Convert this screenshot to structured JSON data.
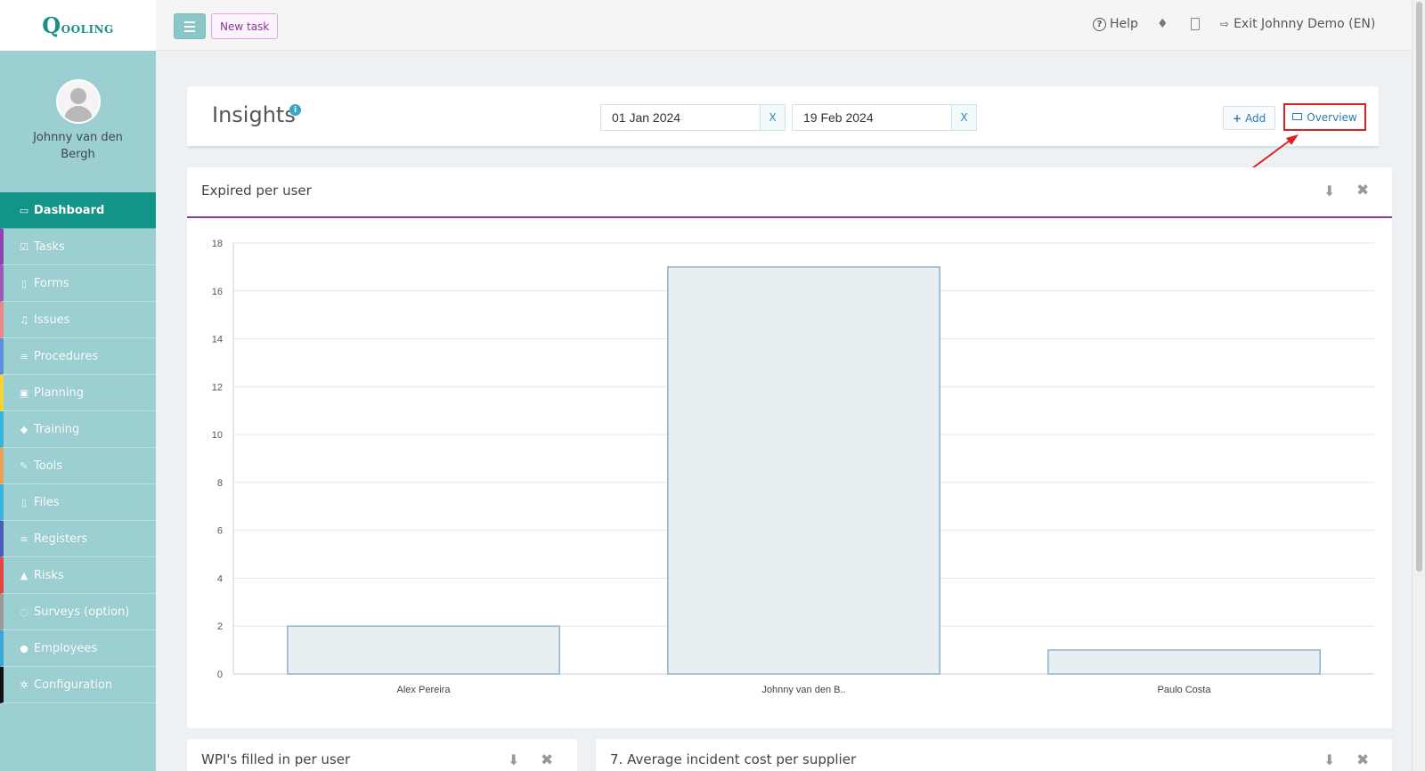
{
  "app": {
    "logo_text": "Qooling"
  },
  "topbar": {
    "new_task": "New task",
    "help": "Help",
    "exit": "Exit Johnny Demo (EN)"
  },
  "profile": {
    "name": "Johnny van den Bergh"
  },
  "nav": {
    "items": [
      {
        "label": "Dashboard",
        "icon": "monitor-icon",
        "glyph": "▭",
        "color": "#139488"
      },
      {
        "label": "Tasks",
        "icon": "checkbox-icon",
        "glyph": "☑",
        "color": "#8e44ad"
      },
      {
        "label": "Forms",
        "icon": "document-icon",
        "glyph": "▯",
        "color": "#9b59b6"
      },
      {
        "label": "Issues",
        "icon": "bell-icon",
        "glyph": "♫",
        "color": "#e78989"
      },
      {
        "label": "Procedures",
        "icon": "list-icon",
        "glyph": "≡",
        "color": "#5b8fd6"
      },
      {
        "label": "Planning",
        "icon": "calendar-icon",
        "glyph": "▣",
        "color": "#f0d43a"
      },
      {
        "label": "Training",
        "icon": "graduation-cap-icon",
        "glyph": "◆",
        "color": "#39b3d7"
      },
      {
        "label": "Tools",
        "icon": "wrench-icon",
        "glyph": "✎",
        "color": "#e8a35a"
      },
      {
        "label": "Files",
        "icon": "file-icon",
        "glyph": "▯",
        "color": "#39b3d7"
      },
      {
        "label": "Registers",
        "icon": "list-icon",
        "glyph": "≡",
        "color": "#4a5bb8"
      },
      {
        "label": "Risks",
        "icon": "warning-icon",
        "glyph": "▲",
        "color": "#e04848"
      },
      {
        "label": "Surveys (option)",
        "icon": "comment-icon",
        "glyph": "◌",
        "color": "#999999"
      },
      {
        "label": "Employees",
        "icon": "users-icon",
        "glyph": "●",
        "color": "#39a8d7"
      },
      {
        "label": "Configuration",
        "icon": "gear-icon",
        "glyph": "✲",
        "color": "#111111"
      }
    ]
  },
  "insights": {
    "title": "Insights",
    "info": "i",
    "date_from": "01 Jan 2024",
    "date_to": "19 Feb 2024",
    "clear": "X",
    "add": "Add",
    "overview": "Overview"
  },
  "chart_card": {
    "title": "Expired per user"
  },
  "chart_data": {
    "type": "bar",
    "title": "Expired per user",
    "categories": [
      "Alex Pereira",
      "Johnny van den B..",
      "Paulo Costa"
    ],
    "values": [
      2,
      17,
      1
    ],
    "ylim": [
      0,
      18
    ],
    "yticks": [
      0,
      2,
      4,
      6,
      8,
      10,
      12,
      14,
      16,
      18
    ],
    "xlabel": "",
    "ylabel": "",
    "grid": true,
    "bar_fill": "#e8eff3",
    "bar_stroke": "#8db3cc"
  },
  "bottom_cards": [
    {
      "title": "WPI's filled in per user"
    },
    {
      "title": "7. Average incident cost per supplier"
    }
  ]
}
